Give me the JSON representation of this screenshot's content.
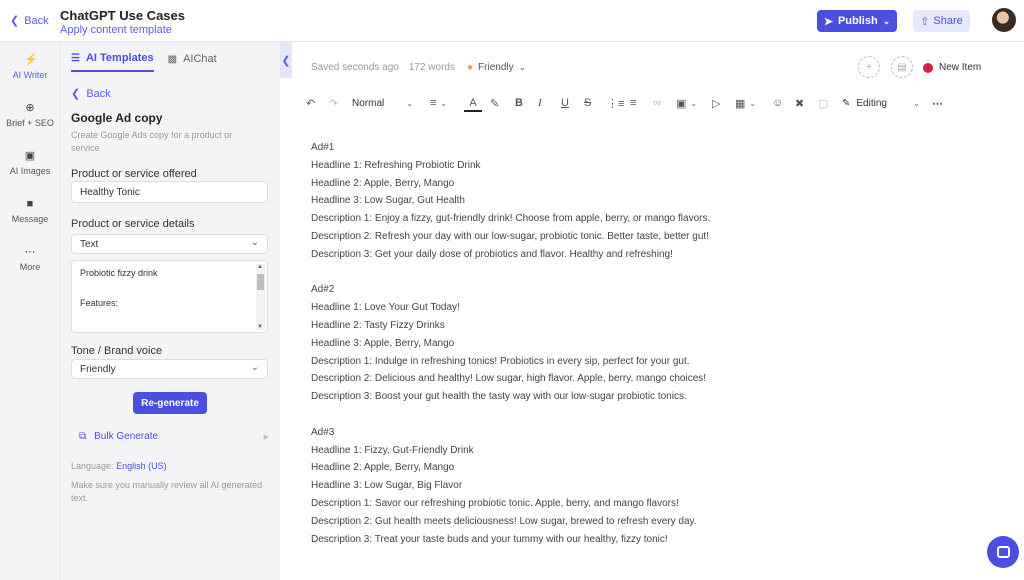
{
  "header": {
    "back_label": "Back",
    "title": "ChatGPT Use Cases",
    "subtitle": "Apply content template",
    "publish_label": "Publish",
    "share_label": "Share"
  },
  "rail": {
    "items": [
      {
        "label": "AI Writer",
        "icon": "lightning-icon"
      },
      {
        "label": "Brief + SEO",
        "icon": "target-icon"
      },
      {
        "label": "AI Images",
        "icon": "image-icon"
      },
      {
        "label": "Message",
        "icon": "message-icon"
      },
      {
        "label": "More",
        "icon": "more-icon"
      }
    ]
  },
  "panel": {
    "tabs": [
      {
        "label": "AI Templates",
        "icon": "templates-icon",
        "active": true
      },
      {
        "label": "AIChat",
        "icon": "chat-icon",
        "active": false
      }
    ],
    "back_label": "Back",
    "template_title": "Google Ad copy",
    "template_description": "Create Google Ads copy for a product or service",
    "fields": {
      "product_label": "Product or service offered",
      "product_value": "Healthy Tonic",
      "details_label": "Product or service details",
      "details_type": "Text",
      "details_text_line1": "Probiotic fizzy drink",
      "details_text_line2": "Features:",
      "tone_label": "Tone / Brand voice",
      "tone_value": "Friendly"
    },
    "regenerate_label": "Re-generate",
    "bulk_label": "Bulk Generate",
    "language_label": "Language:",
    "language_value": "English (US)",
    "review_note": "Make sure you manually review all AI generated text."
  },
  "editor": {
    "saved_status": "Saved seconds ago",
    "word_count": "172 words",
    "tone": "Friendly",
    "new_item_label": "New Item",
    "new_item_color": "#d9204a",
    "toolbar": {
      "style_value": "Normal",
      "mode_value": "Editing"
    },
    "ads": [
      {
        "id": "Ad#1",
        "lines": [
          "Headline 1: Refreshing Probiotic Drink",
          "Headline 2: Apple, Berry, Mango",
          "Headline 3: Low Sugar, Gut Health",
          "Description 1: Enjoy a fizzy, gut-friendly drink! Choose from apple, berry, or mango flavors.",
          "Description 2: Refresh your day with our low-sugar, probiotic tonic. Better taste, better gut!",
          "Description 3: Get your daily dose of probiotics and flavor. Healthy and refreshing!"
        ]
      },
      {
        "id": "Ad#2",
        "lines": [
          "Headline 1: Love Your Gut Today!",
          "Headline 2: Tasty Fizzy Drinks",
          "Headline 3: Apple, Berry, Mango",
          "Description 1: Indulge in refreshing tonics! Probiotics in every sip, perfect for your gut.",
          "Description 2: Delicious and healthy! Low sugar, high flavor. Apple, berry, mango choices!",
          "Description 3: Boost your gut health the tasty way with our low-sugar probiotic tonics."
        ]
      },
      {
        "id": "Ad#3",
        "lines": [
          "Headline 1: Fizzy, Gut-Friendly Drink",
          "Headline 2: Apple, Berry, Mango",
          "Headline 3: Low Sugar, Big Flavor",
          "Description 1: Savor our refreshing probiotic tonic. Apple, berry, and mango flavors!",
          "Description 2: Gut health meets deliciousness! Low sugar, brewed to refresh every day.",
          "Description 3: Treat your taste buds and your tummy with our healthy, fizzy tonic!"
        ]
      }
    ]
  },
  "colors": {
    "accent": "#4b4fe0",
    "panel_bg": "#f4f4f7"
  }
}
